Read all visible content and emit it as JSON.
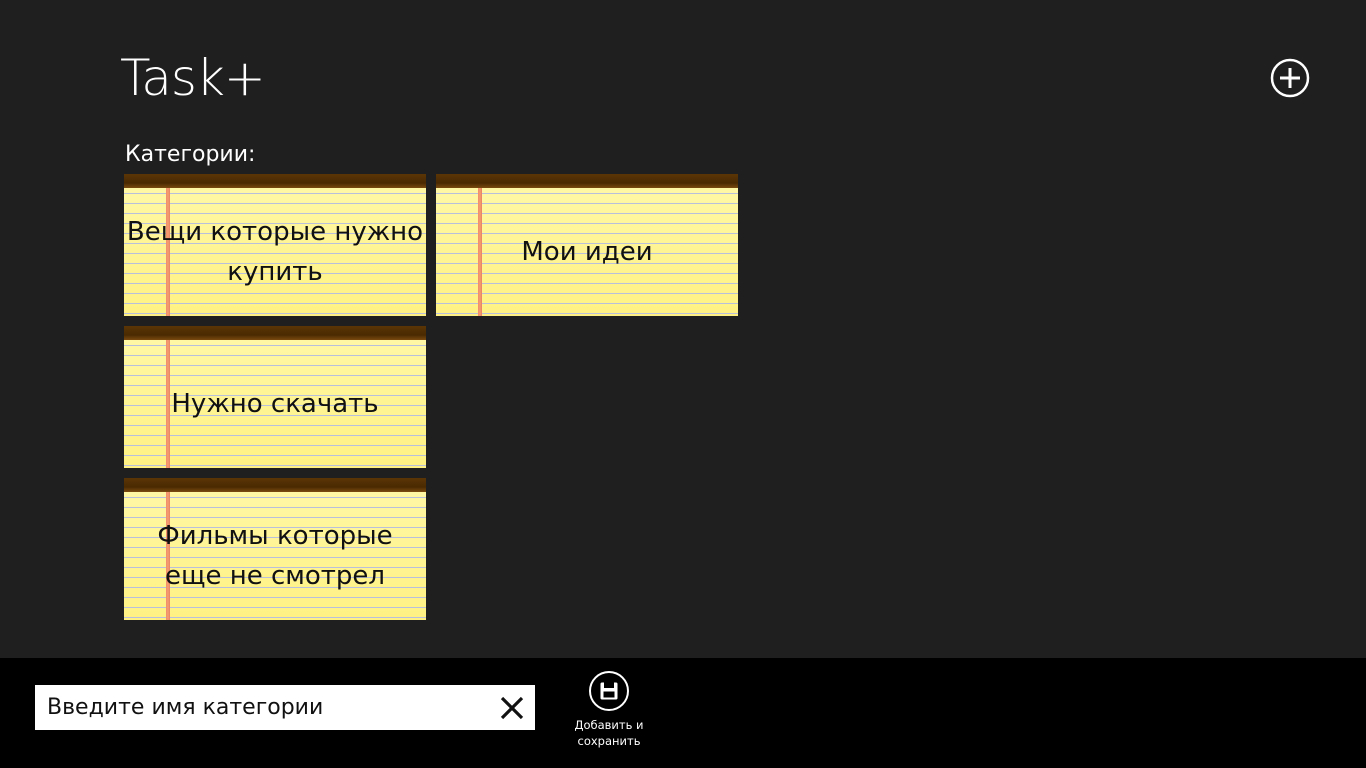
{
  "app": {
    "title": "Task+"
  },
  "header": {
    "add_icon": "plus-circle-icon"
  },
  "categories": {
    "label": "Категории:",
    "items": [
      {
        "label": "Вещи которые нужно купить"
      },
      {
        "label": "Мои идеи"
      },
      {
        "label": "Нужно скачать"
      },
      {
        "label": "Фильмы которые еще не смотрел"
      }
    ]
  },
  "app_bar": {
    "name_input": {
      "value": "Введите имя категории",
      "clear_icon": "close-icon"
    },
    "save": {
      "label_line1": "Добавить и",
      "label_line2": "сохранить",
      "icon": "save-icon"
    }
  },
  "colors": {
    "background": "#1f1f1f",
    "app_bar": "#000000",
    "tile_paper": "#fff699",
    "tile_header": "#5b3505",
    "tile_margin_line": "#f08a6a",
    "tile_ruled_line": "#b7bfdc"
  }
}
